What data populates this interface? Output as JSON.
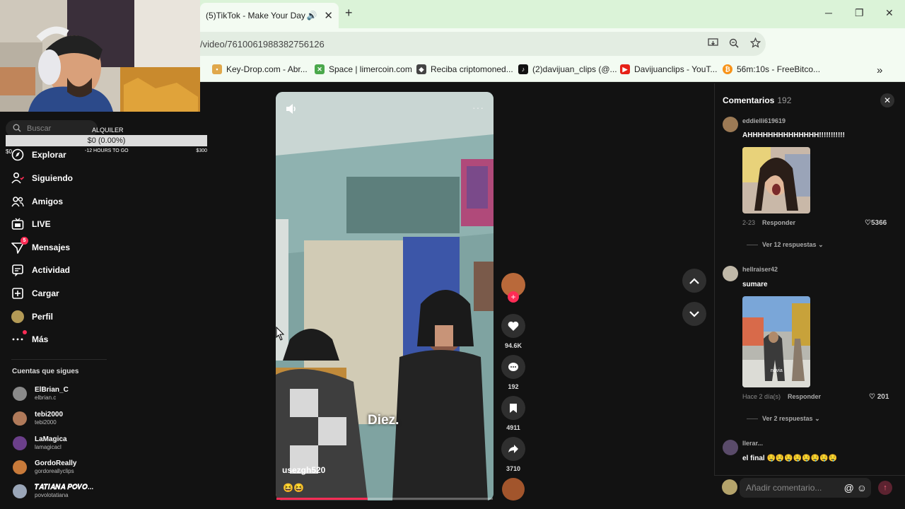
{
  "browser": {
    "tab_title": "(5)TikTok - Make Your Day",
    "speaker_icon": "🔊",
    "close_glyph": "✕",
    "newtab_glyph": "+",
    "url": "/video/7610061988382756126",
    "window": {
      "min": "─",
      "restore": "❐",
      "close": "✕"
    },
    "bookmarks": [
      {
        "label": "Key-Drop.com - Abr...",
        "color": "#e0a84b"
      },
      {
        "label": "Space | limercoin.com",
        "color": "#4aa84b"
      },
      {
        "label": "Reciba criptomoned...",
        "color": "#444444"
      },
      {
        "label": "(2)davijuan_clips (@...",
        "color": "#111111"
      },
      {
        "label": "Davijuanclips - YouT...",
        "color": "#e62117"
      },
      {
        "label": "56m:10s - FreeBitco...",
        "color": "#f7931a"
      }
    ],
    "bookmark_more": "»"
  },
  "rent_widget": {
    "label": "ALQUILER",
    "value": "$0 (0.00%)",
    "subtitle": "-12 HOURS TO GO",
    "min": "$0",
    "max": "$300"
  },
  "sidebar": {
    "search_placeholder": "Buscar",
    "items": [
      {
        "label": "Explorar",
        "icon": "compass-icon"
      },
      {
        "label": "Siguiendo",
        "icon": "following-icon"
      },
      {
        "label": "Amigos",
        "icon": "friends-icon"
      },
      {
        "label": "LIVE",
        "icon": "live-icon"
      },
      {
        "label": "Mensajes",
        "icon": "messages-icon",
        "badge": "5"
      },
      {
        "label": "Actividad",
        "icon": "activity-icon"
      },
      {
        "label": "Cargar",
        "icon": "upload-icon"
      },
      {
        "label": "Perfil",
        "icon": "profile-icon"
      },
      {
        "label": "Más",
        "icon": "more-icon"
      }
    ],
    "following_header": "Cuentas que sigues",
    "accounts": [
      {
        "name": "ElBrian_C",
        "handle": "elbrian.c",
        "color": "#8a8a8a"
      },
      {
        "name": "tebi2000",
        "handle": "tebi2000",
        "color": "#b07a5a"
      },
      {
        "name": "LaMagica",
        "handle": "lamagicacl",
        "color": "#6b3f8a"
      },
      {
        "name": "GordoReally",
        "handle": "gordoreallyclips",
        "color": "#c87a3a"
      },
      {
        "name": "𝑻𝑨𝑻𝑰𝑨𝑵𝑨 𝑷𝑶𝑽𝑶...",
        "handle": "povolotatiana",
        "color": "#9aa6b8"
      }
    ]
  },
  "video": {
    "caption": "Diez.",
    "author": "usezgh520",
    "description": "😆😆",
    "more_glyph": "···",
    "volume_icon": "🔈",
    "progress": 0.42,
    "likes": "94.6K",
    "comments": "192",
    "saves": "4911",
    "shares": "3710"
  },
  "comments_panel": {
    "title": "Comentarios",
    "count": "192",
    "close_glyph": "✕",
    "comments": [
      {
        "user": "eddielli619619",
        "text": "AHHHHHHHHHHHHHH!!!!!!!!!!!",
        "date": "2-23",
        "reply": "Responder",
        "likes": "5366",
        "replies": "Ver 12 respuestas",
        "avatar_color": "#9c7a55"
      },
      {
        "user": "hellraiser42",
        "text": "sumare",
        "date": "Hace 2 día(s)",
        "reply": "Responder",
        "likes": "201",
        "replies": "Ver 2 respuestas",
        "avatar_color": "#c0b8a8",
        "image_label": "novia"
      },
      {
        "user": "llerar...",
        "text": "el final 🤤🤤🤤🤤🤤🤤🤤🤤",
        "avatar_color": "#5a4b6a"
      }
    ],
    "input_placeholder": "Añadir comentario...",
    "input_icons": "@ ☺",
    "send_glyph": "↑"
  }
}
